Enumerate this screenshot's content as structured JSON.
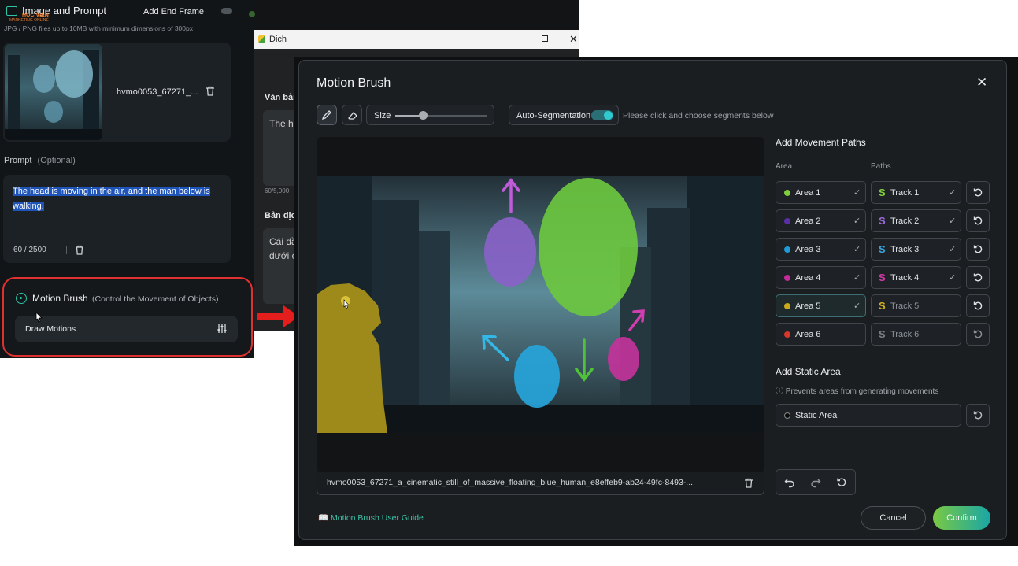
{
  "left_panel": {
    "title": "Image and Prompt",
    "add_end_frame": "Add End Frame",
    "file_hint": "JPG / PNG files up to 10MB with minimum dimensions of 300px",
    "logo_text": "HỌC VIỆN",
    "logo_sub": "MARKETING ONLINE",
    "image_filename": "hvmo0053_67271_...",
    "prompt_label": "Prompt",
    "prompt_optional": "(Optional)",
    "prompt_text": "The head is moving in the air, and the man below is walking.",
    "prompt_count": "60 / 2500",
    "motion_brush_title": "Motion Brush",
    "motion_brush_sub": "(Control the Movement of Objects)",
    "draw_motions": "Draw Motions"
  },
  "translate_window": {
    "title": "Dich",
    "source_label": "Văn bản",
    "source_text": "The h",
    "source_count": "60/5,000",
    "result_label": "Bản dịch",
    "result_text_1": "Cái đầ",
    "result_text_2": "dưới c"
  },
  "modal": {
    "title": "Motion Brush",
    "size_label": "Size",
    "size_value": 0.3,
    "auto_seg_label": "Auto-Segmentation",
    "auto_seg_on": true,
    "hint": "Please click and choose segments below",
    "add_paths_title": "Add Movement Paths",
    "area_col": "Area",
    "paths_col": "Paths",
    "areas": [
      {
        "label": "Area 1",
        "color": "#7fcf3d",
        "checked": true,
        "track": "Track 1",
        "track_color": "#7fcf3d",
        "track_checked": true
      },
      {
        "label": "Area 2",
        "color": "#5a2ea6",
        "checked": true,
        "track": "Track 2",
        "track_color": "#9c6ad9",
        "track_checked": true
      },
      {
        "label": "Area 3",
        "color": "#1f9ad6",
        "checked": true,
        "track": "Track 3",
        "track_color": "#3aa6e0",
        "track_checked": true
      },
      {
        "label": "Area 4",
        "color": "#c72a9a",
        "checked": true,
        "track": "Track 4",
        "track_color": "#d23aa8",
        "track_checked": true
      },
      {
        "label": "Area 5",
        "color": "#c9a81a",
        "checked": true,
        "track": "Track 5",
        "track_color": "#d4b21f",
        "track_checked": false
      },
      {
        "label": "Area 6",
        "color": "#d9362b",
        "checked": false,
        "track": "Track 6",
        "track_color": "#7c8288",
        "track_checked": false
      }
    ],
    "static_title": "Add Static Area",
    "static_hint": "Prevents areas from generating movements",
    "static_area": "Static Area",
    "filename": "hvmo0053_67271_a_cinematic_still_of_massive_floating_blue_human_e8effeb9-ab24-49fc-8493-...",
    "guide": "Motion Brush User Guide",
    "cancel": "Cancel",
    "confirm": "Confirm",
    "accent": "#23b5b8",
    "confirm_gradient": [
      "#7ac943",
      "#1aa6a6"
    ]
  }
}
